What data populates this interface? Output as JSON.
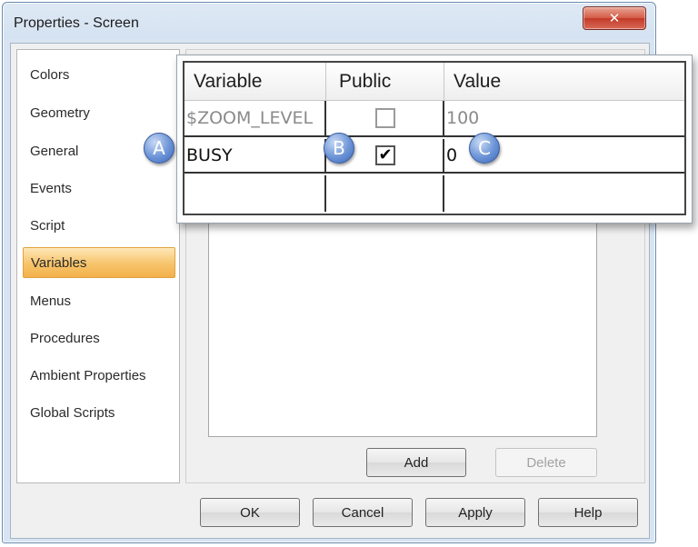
{
  "window": {
    "title": "Properties - Screen",
    "close_glyph": "✕"
  },
  "nav": {
    "items": [
      {
        "label": "Colors",
        "selected": false
      },
      {
        "label": "Geometry",
        "selected": false
      },
      {
        "label": "General",
        "selected": false
      },
      {
        "label": "Events",
        "selected": false
      },
      {
        "label": "Script",
        "selected": false
      },
      {
        "label": "Variables",
        "selected": true
      },
      {
        "label": "Menus",
        "selected": false
      },
      {
        "label": "Procedures",
        "selected": false
      },
      {
        "label": "Ambient Properties",
        "selected": false
      },
      {
        "label": "Global Scripts",
        "selected": false
      }
    ]
  },
  "variables_grid": {
    "columns": [
      "Variable",
      "Public",
      "Value"
    ],
    "rows": [
      {
        "variable": "$ZOOM_LEVEL",
        "public": false,
        "value": "100"
      },
      {
        "variable": "BUSY",
        "public": true,
        "value": "0"
      },
      {
        "variable": "",
        "public": null,
        "value": ""
      }
    ],
    "check_glyph": "✔"
  },
  "callouts": {
    "a": "A",
    "b": "B",
    "c": "C"
  },
  "panel": {
    "add_label": "Add",
    "delete_label": "Delete"
  },
  "footer": {
    "ok_label": "OK",
    "cancel_label": "Cancel",
    "apply_label": "Apply",
    "help_label": "Help"
  },
  "colors": {
    "selected_item": "#f7c46b",
    "callout": "#6b93d6",
    "close_button": "#d45a45"
  }
}
